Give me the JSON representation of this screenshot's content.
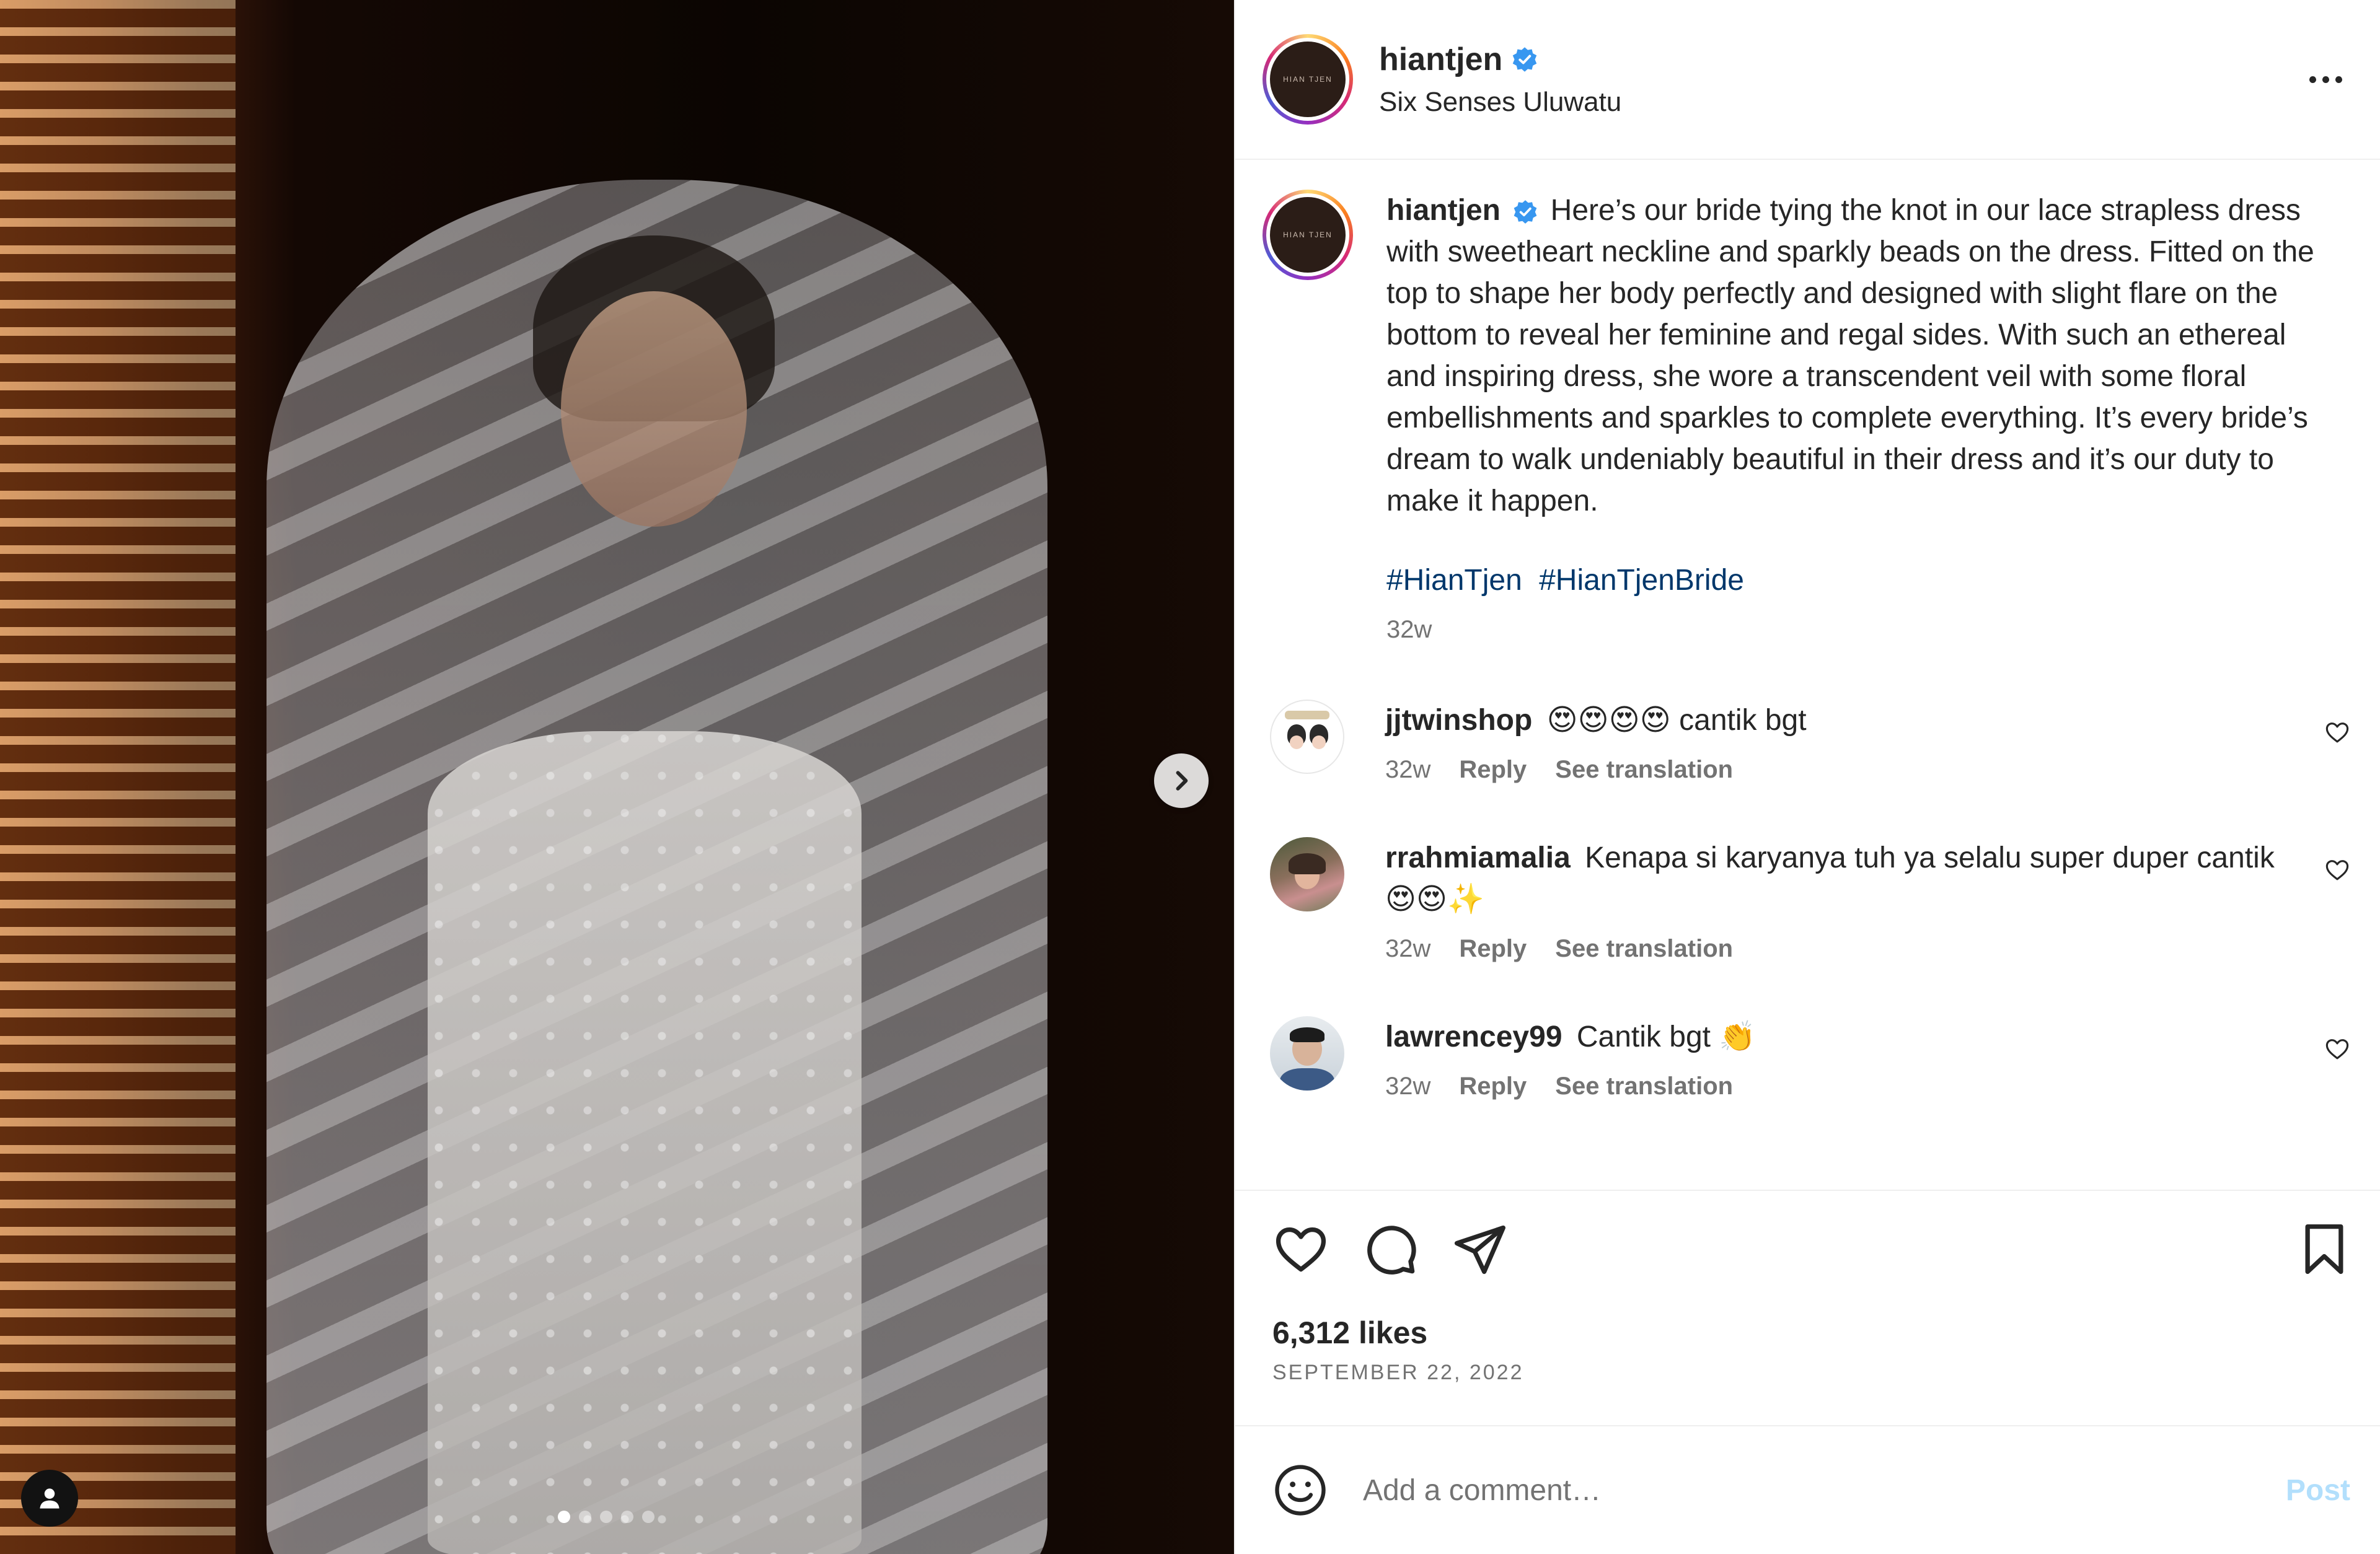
{
  "post": {
    "username": "hiantjen",
    "verified": true,
    "location": "Six Senses Uluwatu",
    "avatar_text": "HIAN TJEN",
    "caption": "Here’s our bride tying the knot in our lace strapless dress with sweetheart neckline and sparkly beads on the dress. Fitted on the top to shape her body perfectly and designed with slight flare on the bottom to reveal her feminine and regal sides. With such an ethereal and inspiring dress, she wore a transcendent veil with some floral embellishments and sparkles to complete everything. It’s every bride’s dream to walk undeniably beautiful in their dress and it’s our duty to make it happen.",
    "hashtags": [
      "#HianTjen",
      "#HianTjenBride"
    ],
    "caption_time": "32w",
    "likes": "6,312 likes",
    "date": "SEPTEMBER 22, 2022"
  },
  "carousel": {
    "total": 5,
    "active": 0
  },
  "comments": [
    {
      "username": "jjtwinshop",
      "text": "😍😍😍😍 cantik bgt",
      "time": "32w",
      "reply": "Reply",
      "translate": "See translation"
    },
    {
      "username": "rrahmiamalia",
      "text": "Kenapa si karyanya tuh ya selalu super duper cantik😍😍✨",
      "time": "32w",
      "reply": "Reply",
      "translate": "See translation"
    },
    {
      "username": "lawrencey99",
      "text": "Cantik bgt 👏",
      "time": "32w",
      "reply": "Reply",
      "translate": "See translation"
    }
  ],
  "composer": {
    "placeholder": "Add a comment…",
    "post_label": "Post"
  },
  "colors": {
    "link": "#00376b",
    "verified": "#3897f0",
    "post_disabled": "#b2dffc",
    "muted": "#737373"
  },
  "icons": [
    "chevron-right-icon",
    "user-tag-icon",
    "verified-icon",
    "more-icon",
    "heart-icon",
    "comment-icon",
    "share-icon",
    "bookmark-icon",
    "emoji-icon"
  ]
}
